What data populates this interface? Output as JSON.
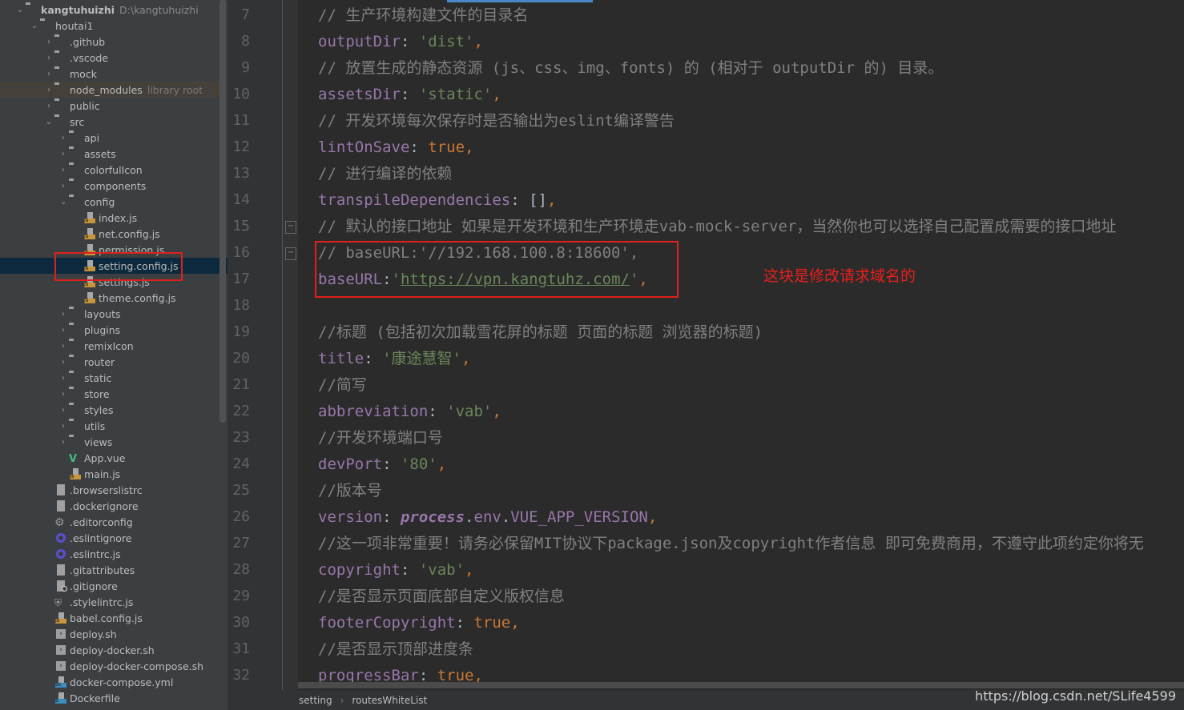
{
  "project_tree": {
    "root": {
      "label": "kangtuhuizhi",
      "path": "D:\\kangtuhuizhi"
    },
    "items": [
      {
        "label": "houtai1",
        "level": 1,
        "type": "folder",
        "state": "open"
      },
      {
        "label": ".github",
        "level": 2,
        "type": "folder",
        "state": "closed"
      },
      {
        "label": ".vscode",
        "level": 2,
        "type": "folder",
        "state": "closed"
      },
      {
        "label": "mock",
        "level": 2,
        "type": "folder",
        "state": "closed"
      },
      {
        "label": "node_modules",
        "level": 2,
        "type": "folder",
        "state": "closed",
        "hint": "library root"
      },
      {
        "label": "public",
        "level": 2,
        "type": "folder",
        "state": "closed"
      },
      {
        "label": "src",
        "level": 2,
        "type": "folder",
        "state": "open"
      },
      {
        "label": "api",
        "level": 3,
        "type": "folder",
        "state": "closed"
      },
      {
        "label": "assets",
        "level": 3,
        "type": "folder",
        "state": "closed"
      },
      {
        "label": "colorfulIcon",
        "level": 3,
        "type": "folder",
        "state": "closed"
      },
      {
        "label": "components",
        "level": 3,
        "type": "folder",
        "state": "closed"
      },
      {
        "label": "config",
        "level": 3,
        "type": "folder",
        "state": "open"
      },
      {
        "label": "index.js",
        "level": 4,
        "type": "js"
      },
      {
        "label": "net.config.js",
        "level": 4,
        "type": "js"
      },
      {
        "label": "permission.js",
        "level": 4,
        "type": "js"
      },
      {
        "label": "setting.config.js",
        "level": 4,
        "type": "js",
        "selected": true
      },
      {
        "label": "settings.js",
        "level": 4,
        "type": "js"
      },
      {
        "label": "theme.config.js",
        "level": 4,
        "type": "js"
      },
      {
        "label": "layouts",
        "level": 3,
        "type": "folder",
        "state": "closed"
      },
      {
        "label": "plugins",
        "level": 3,
        "type": "folder",
        "state": "closed"
      },
      {
        "label": "remixIcon",
        "level": 3,
        "type": "folder",
        "state": "closed"
      },
      {
        "label": "router",
        "level": 3,
        "type": "folder",
        "state": "closed"
      },
      {
        "label": "static",
        "level": 3,
        "type": "folder",
        "state": "closed"
      },
      {
        "label": "store",
        "level": 3,
        "type": "folder",
        "state": "closed"
      },
      {
        "label": "styles",
        "level": 3,
        "type": "folder",
        "state": "closed"
      },
      {
        "label": "utils",
        "level": 3,
        "type": "folder",
        "state": "closed"
      },
      {
        "label": "views",
        "level": 3,
        "type": "folder",
        "state": "closed"
      },
      {
        "label": "App.vue",
        "level": 3,
        "type": "vue"
      },
      {
        "label": "main.js",
        "level": 3,
        "type": "js"
      },
      {
        "label": ".browserslistrc",
        "level": 2,
        "type": "text"
      },
      {
        "label": ".dockerignore",
        "level": 2,
        "type": "text"
      },
      {
        "label": ".editorconfig",
        "level": 2,
        "type": "gear"
      },
      {
        "label": ".eslintignore",
        "level": 2,
        "type": "eslint"
      },
      {
        "label": ".eslintrc.js",
        "level": 2,
        "type": "eslint"
      },
      {
        "label": ".gitattributes",
        "level": 2,
        "type": "text"
      },
      {
        "label": ".gitignore",
        "level": 2,
        "type": "gitignore"
      },
      {
        "label": ".stylelintrc.js",
        "level": 2,
        "type": "stylelint"
      },
      {
        "label": "babel.config.js",
        "level": 2,
        "type": "js"
      },
      {
        "label": "deploy.sh",
        "level": 2,
        "type": "shell"
      },
      {
        "label": "deploy-docker.sh",
        "level": 2,
        "type": "shell"
      },
      {
        "label": "deploy-docker-compose.sh",
        "level": 2,
        "type": "shell"
      },
      {
        "label": "docker-compose.yml",
        "level": 2,
        "type": "docker-compose"
      },
      {
        "label": "Dockerfile",
        "level": 2,
        "type": "dockerfile"
      }
    ]
  },
  "editor": {
    "first_line": 7,
    "lines": [
      [
        [
          "c",
          "// 生产环境构建文件的目录名"
        ]
      ],
      [
        [
          "k",
          "outputDir"
        ],
        [
          "o",
          ": "
        ],
        [
          "s",
          "'dist'"
        ],
        [
          "p",
          ","
        ]
      ],
      [
        [
          "c",
          "// 放置生成的静态资源 (js、css、img、fonts) 的 (相对于 outputDir 的) 目录。"
        ]
      ],
      [
        [
          "k",
          "assetsDir"
        ],
        [
          "o",
          ": "
        ],
        [
          "s",
          "'static'"
        ],
        [
          "p",
          ","
        ]
      ],
      [
        [
          "c",
          "// 开发环境每次保存时是否输出为eslint编译警告"
        ]
      ],
      [
        [
          "k",
          "lintOnSave"
        ],
        [
          "o",
          ": "
        ],
        [
          "b",
          "true"
        ],
        [
          "p",
          ","
        ]
      ],
      [
        [
          "c",
          "// 进行编译的依赖"
        ]
      ],
      [
        [
          "k",
          "transpileDependencies"
        ],
        [
          "o",
          ": []"
        ],
        [
          "p",
          ","
        ]
      ],
      [
        [
          "c",
          "// 默认的接口地址 如果是开发环境和生产环境走vab-mock-server，当然你也可以选择自己配置成需要的接口地址"
        ]
      ],
      [
        [
          "c",
          "// baseURL:'//192.168.100.8:18600',"
        ]
      ],
      [
        [
          "k",
          "baseURL"
        ],
        [
          "o",
          ":"
        ],
        [
          "s",
          "'"
        ],
        [
          "u",
          "https://vpn.kangtuhz.com/"
        ],
        [
          "s",
          "'"
        ],
        [
          "p",
          ","
        ]
      ],
      [],
      [
        [
          "c",
          "//标题 (包括初次加载雪花屏的标题 页面的标题 浏览器的标题)"
        ]
      ],
      [
        [
          "k",
          "title"
        ],
        [
          "o",
          ": "
        ],
        [
          "s",
          "'康途慧智'"
        ],
        [
          "p",
          ","
        ]
      ],
      [
        [
          "c",
          "//简写"
        ]
      ],
      [
        [
          "k",
          "abbreviation"
        ],
        [
          "o",
          ": "
        ],
        [
          "s",
          "'vab'"
        ],
        [
          "p",
          ","
        ]
      ],
      [
        [
          "c",
          "//开发环境端口号"
        ]
      ],
      [
        [
          "k",
          "devPort"
        ],
        [
          "o",
          ": "
        ],
        [
          "s",
          "'80'"
        ],
        [
          "p",
          ","
        ]
      ],
      [
        [
          "c",
          "//版本号"
        ]
      ],
      [
        [
          "k",
          "version"
        ],
        [
          "o",
          ": "
        ],
        [
          "i",
          "process"
        ],
        [
          "o",
          "."
        ],
        [
          "k",
          "env"
        ],
        [
          "o",
          "."
        ],
        [
          "k",
          "VUE_APP_VERSION"
        ],
        [
          "p",
          ","
        ]
      ],
      [
        [
          "c",
          "//这一项非常重要！请务必保留MIT协议下package.json及copyright作者信息 即可免费商用，不遵守此项约定你将无"
        ]
      ],
      [
        [
          "k",
          "copyright"
        ],
        [
          "o",
          ": "
        ],
        [
          "s",
          "'vab'"
        ],
        [
          "p",
          ","
        ]
      ],
      [
        [
          "c",
          "//是否显示页面底部自定义版权信息"
        ]
      ],
      [
        [
          "k",
          "footerCopyright"
        ],
        [
          "o",
          ": "
        ],
        [
          "b",
          "true"
        ],
        [
          "p",
          ","
        ]
      ],
      [
        [
          "c",
          "//是否显示顶部进度条"
        ]
      ],
      [
        [
          "k",
          "progressBar"
        ],
        [
          "o",
          ": "
        ],
        [
          "b",
          "true"
        ],
        [
          "p",
          ","
        ]
      ]
    ]
  },
  "annotation": {
    "text": "这块是修改请求域名的",
    "color": "#e8201c"
  },
  "breadcrumb": [
    "setting",
    "routesWhiteList"
  ],
  "watermark": "https://blog.csdn.net/SLife4599",
  "colors": {
    "tree_bg": "#3c3f41",
    "editor_bg": "#2b2b2b",
    "key": "#9876aa",
    "string": "#6a8759",
    "keyword": "#cc7832",
    "comment": "#808080",
    "selection": "#0d293e",
    "highlight_box": "#e0201c"
  }
}
